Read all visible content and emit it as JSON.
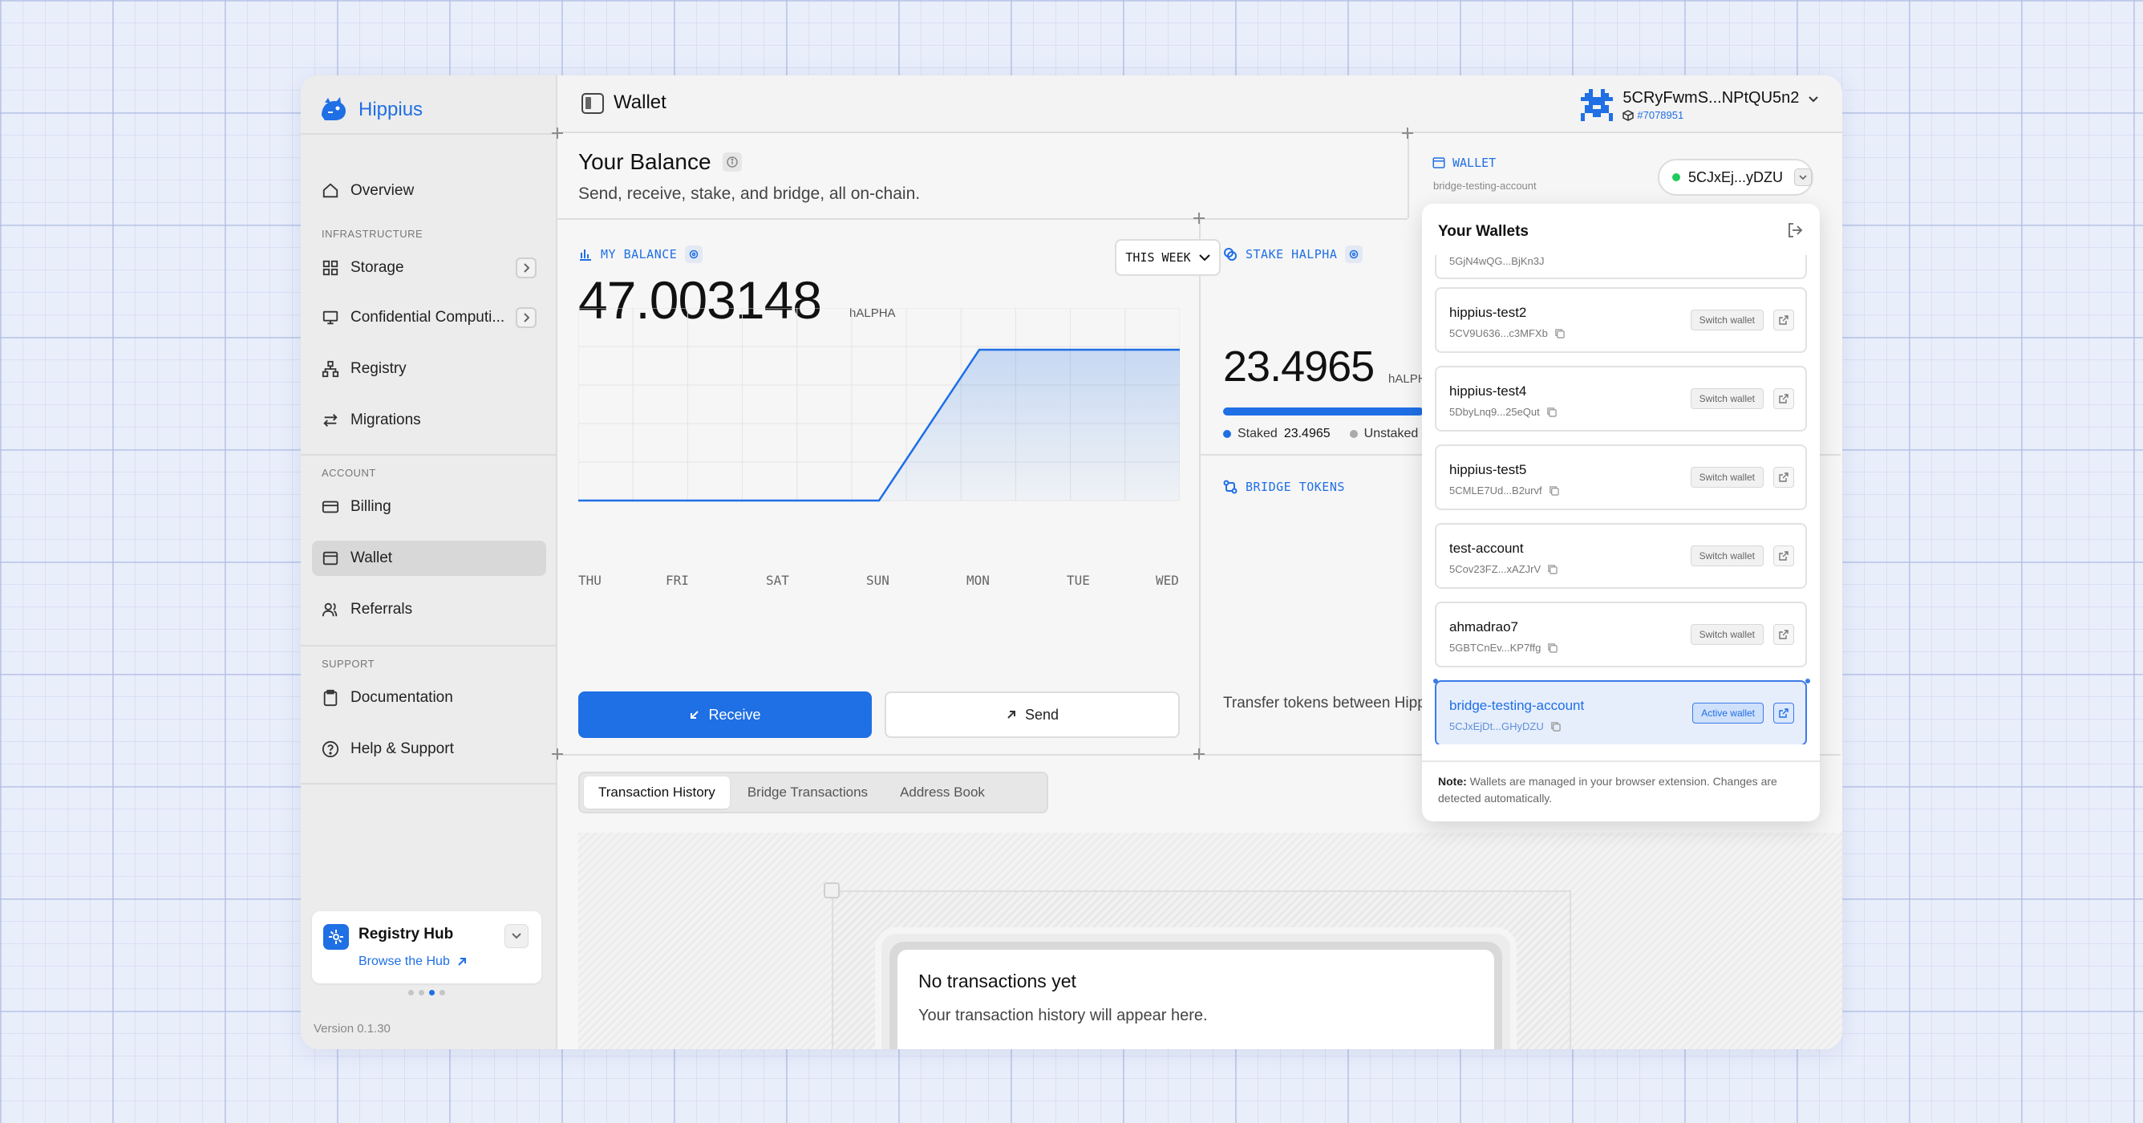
{
  "app": {
    "brand": "Hippius",
    "page_title": "Wallet",
    "version": "Version 0.1.30"
  },
  "account": {
    "id": "5CRyFwmS...NPtQU5n2",
    "block": "#7078951"
  },
  "sidebar": {
    "overview": "Overview",
    "infra_label": "INFRASTRUCTURE",
    "storage": "Storage",
    "compute": "Confidential Computi...",
    "registry": "Registry",
    "migrations": "Migrations",
    "account_label": "ACCOUNT",
    "billing": "Billing",
    "wallet": "Wallet",
    "referrals": "Referrals",
    "support_label": "SUPPORT",
    "documentation": "Documentation",
    "help": "Help & Support",
    "hub_title": "Registry Hub",
    "hub_link": "Browse the Hub"
  },
  "balance": {
    "title": "Your Balance",
    "subtitle": "Send, receive, stake, and bridge, all on-chain.",
    "label": "MY BALANCE",
    "amount": "47.003148",
    "unit": "hALPHA",
    "range": "THIS WEEK",
    "receive": "Receive",
    "send": "Send"
  },
  "chart_data": {
    "type": "area",
    "categories": [
      "THU",
      "FRI",
      "SAT",
      "SUN",
      "MON",
      "TUE",
      "WED"
    ],
    "values": [
      0,
      0,
      0,
      0,
      47.003148,
      47.003148,
      47.003148
    ],
    "title": "",
    "xlabel": "",
    "ylabel": "",
    "ylim": [
      0,
      60
    ],
    "grid": true,
    "accent": "#1f6fe5"
  },
  "stake": {
    "label": "STAKE HALPHA",
    "amount": "23.4965",
    "unit": "hALPH",
    "staked_label": "Staked",
    "staked_value": "23.4965",
    "unstaked_label": "Unstaked"
  },
  "bridge": {
    "label": "BRIDGE TOKENS",
    "text": "Transfer tokens between Hippi"
  },
  "tabs": [
    "Transaction History",
    "Bridge Transactions",
    "Address Book"
  ],
  "empty": {
    "title": "No transactions yet",
    "subtitle": "Your transaction history will appear here."
  },
  "wallet_panel": {
    "label": "WALLET",
    "account_name": "bridge-testing-account",
    "active_address": "5CJxEj...yDZU",
    "dropdown_title": "Your Wallets",
    "partial_addr": "5GjN4wQG...BjKn3J",
    "switch_label": "Switch wallet",
    "active_label": "Active wallet",
    "note_bold": "Note:",
    "note_text": " Wallets are managed in your browser extension. Changes are detected automatically.",
    "wallets": [
      {
        "name": "hippius-test2",
        "addr": "5CV9U636...c3MFXb"
      },
      {
        "name": "hippius-test4",
        "addr": "5DbyLnq9...25eQut"
      },
      {
        "name": "hippius-test5",
        "addr": "5CMLE7Ud...B2urvf"
      },
      {
        "name": "test-account",
        "addr": "5Cov23FZ...xAZJrV"
      },
      {
        "name": "ahmadrao7",
        "addr": "5GBTCnEv...KP7ffg"
      },
      {
        "name": "bridge-testing-account",
        "addr": "5CJxEjDt...GHyDZU"
      }
    ]
  },
  "colors": {
    "accent": "#1f6fe5",
    "online": "#1fcb5b"
  }
}
